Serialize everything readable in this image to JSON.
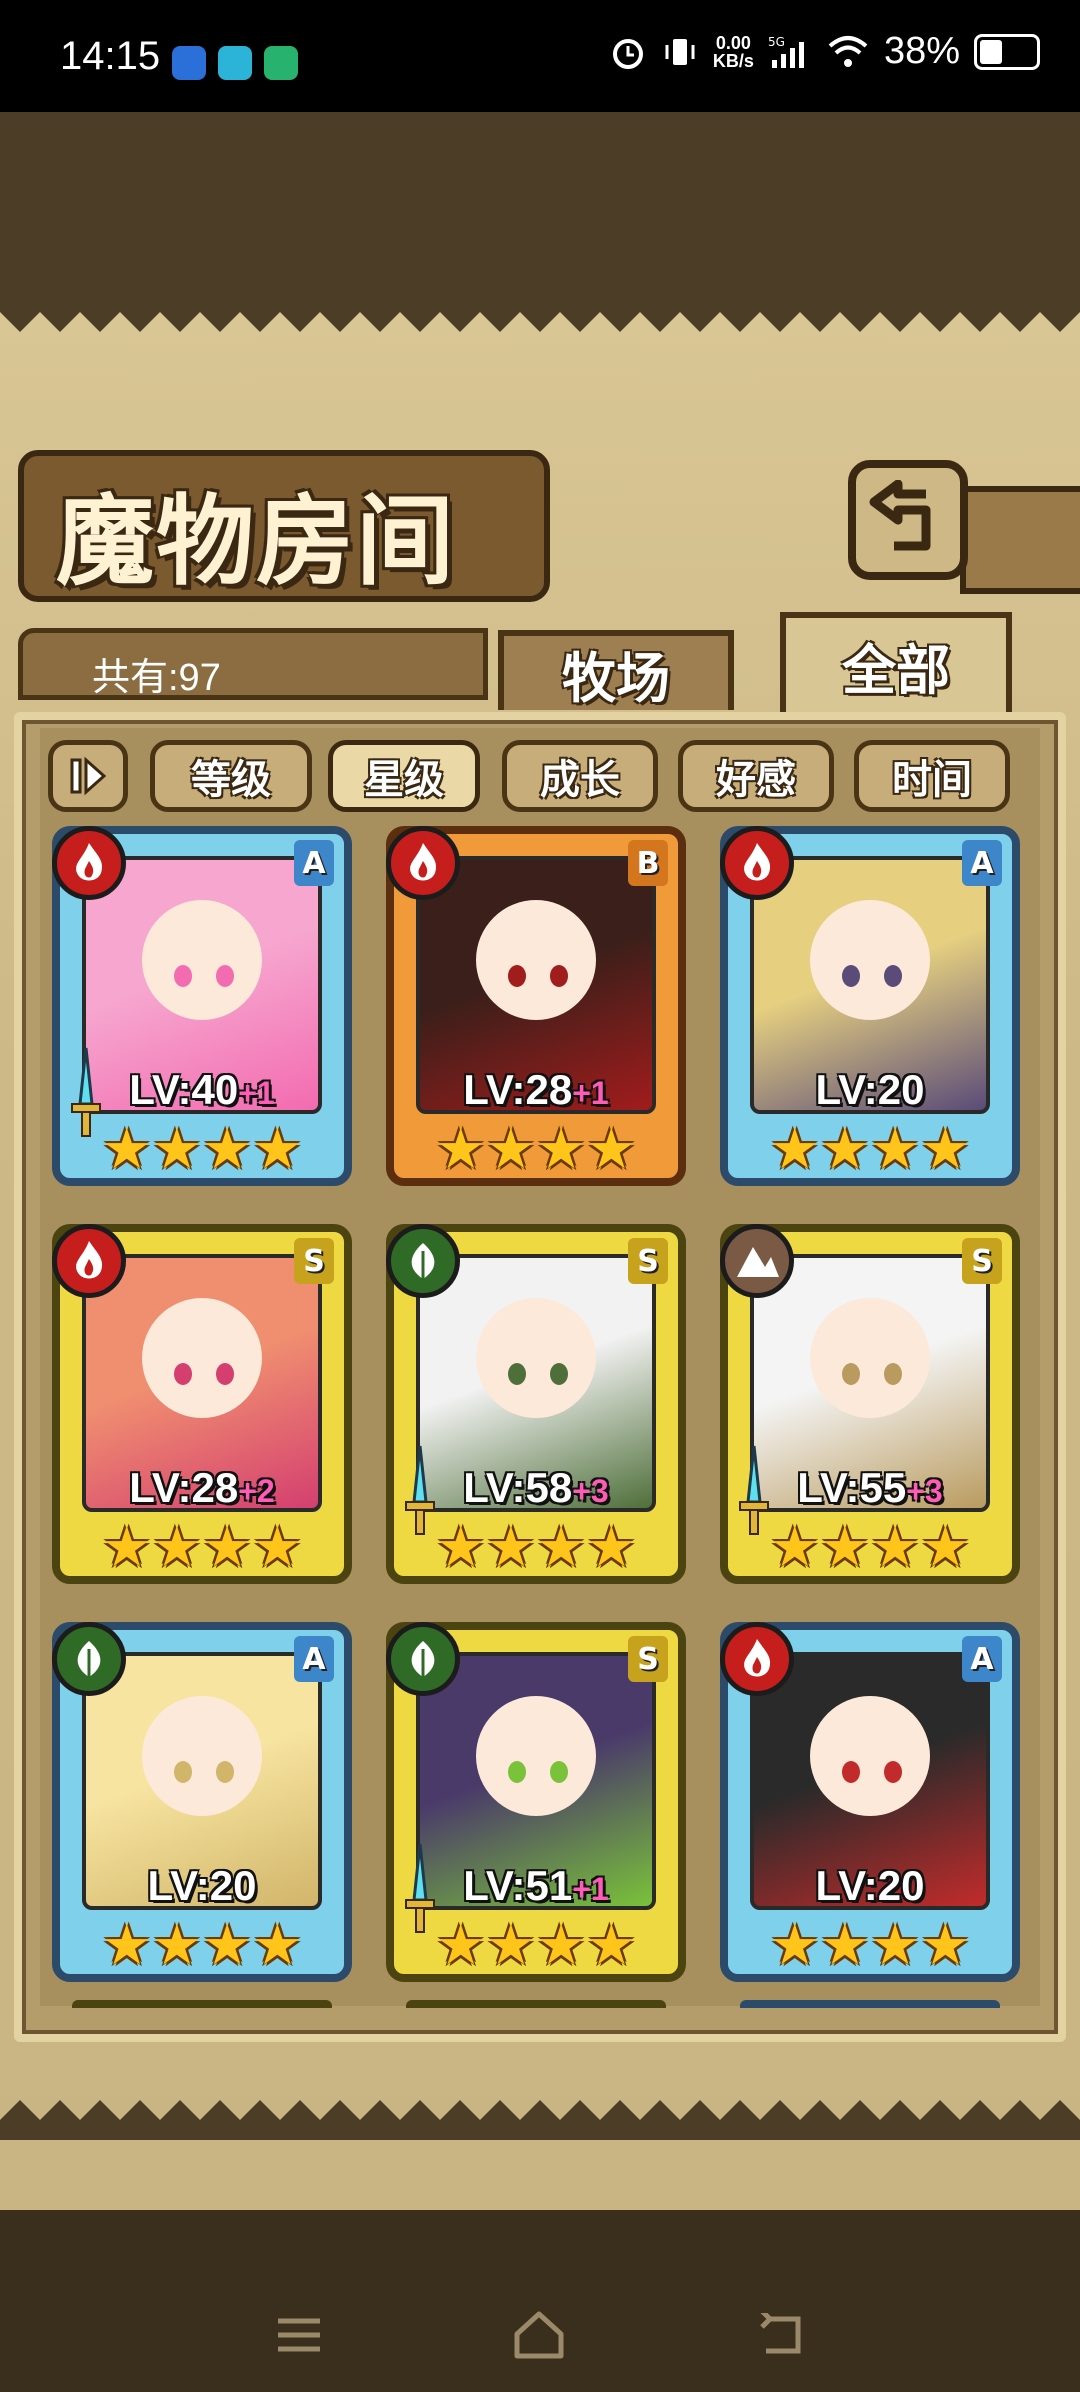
{
  "status_bar": {
    "time": "14:15",
    "net_speed": "0.00",
    "net_unit": "KB/s",
    "network": "5G",
    "battery": "38%",
    "battery_level": 0.38
  },
  "header": {
    "title": "魔物房间",
    "back_icon": "back-arrow-icon"
  },
  "count": {
    "label": "共有:97"
  },
  "tabs": [
    {
      "label": "牧场",
      "active": false
    },
    {
      "label": "全部",
      "active": true
    }
  ],
  "filters": [
    {
      "label": "等级",
      "active": false
    },
    {
      "label": "星级",
      "active": true
    },
    {
      "label": "成长",
      "active": false
    },
    {
      "label": "好感",
      "active": false
    },
    {
      "label": "时间",
      "active": false
    }
  ],
  "cards": [
    {
      "rank": "A",
      "element": "fire",
      "level": "LV:40",
      "plus": "+1",
      "stars": "★★★★",
      "weapon": true,
      "palette": [
        "#f6a6cf",
        "#f36bb0"
      ]
    },
    {
      "rank": "B",
      "element": "fire",
      "level": "LV:28",
      "plus": "+1",
      "stars": "★★★★",
      "weapon": false,
      "palette": [
        "#3a1f1a",
        "#a11c1c"
      ]
    },
    {
      "rank": "A",
      "element": "fire",
      "level": "LV:20",
      "plus": "",
      "stars": "★★★★",
      "weapon": false,
      "palette": [
        "#e6d080",
        "#5a4b78"
      ]
    },
    {
      "rank": "S",
      "element": "fire",
      "level": "LV:28",
      "plus": "+2",
      "stars": "★★★★",
      "weapon": false,
      "palette": [
        "#f08f70",
        "#d43f70"
      ]
    },
    {
      "rank": "S",
      "element": "grass",
      "level": "LV:58",
      "plus": "+3",
      "stars": "★★★★",
      "weapon": true,
      "palette": [
        "#f2f2f2",
        "#4f6f3a"
      ]
    },
    {
      "rank": "S",
      "element": "earth",
      "level": "LV:55",
      "plus": "+3",
      "stars": "★★★★",
      "weapon": true,
      "palette": [
        "#f4f4f4",
        "#b99b5f"
      ]
    },
    {
      "rank": "A",
      "element": "grass",
      "level": "LV:20",
      "plus": "",
      "stars": "★★★★",
      "weapon": false,
      "palette": [
        "#f7e4a0",
        "#d1b56a"
      ]
    },
    {
      "rank": "S",
      "element": "grass",
      "level": "LV:51",
      "plus": "+1",
      "stars": "★★★★",
      "weapon": true,
      "palette": [
        "#4a3a6a",
        "#7ac23a"
      ]
    },
    {
      "rank": "A",
      "element": "fire",
      "level": "LV:20",
      "plus": "",
      "stars": "★★★★",
      "weapon": false,
      "palette": [
        "#2a2a2a",
        "#c22b2b"
      ]
    }
  ],
  "nav": {
    "menu_icon": "menu-icon",
    "home_icon": "home-icon",
    "back_icon": "back-icon"
  }
}
